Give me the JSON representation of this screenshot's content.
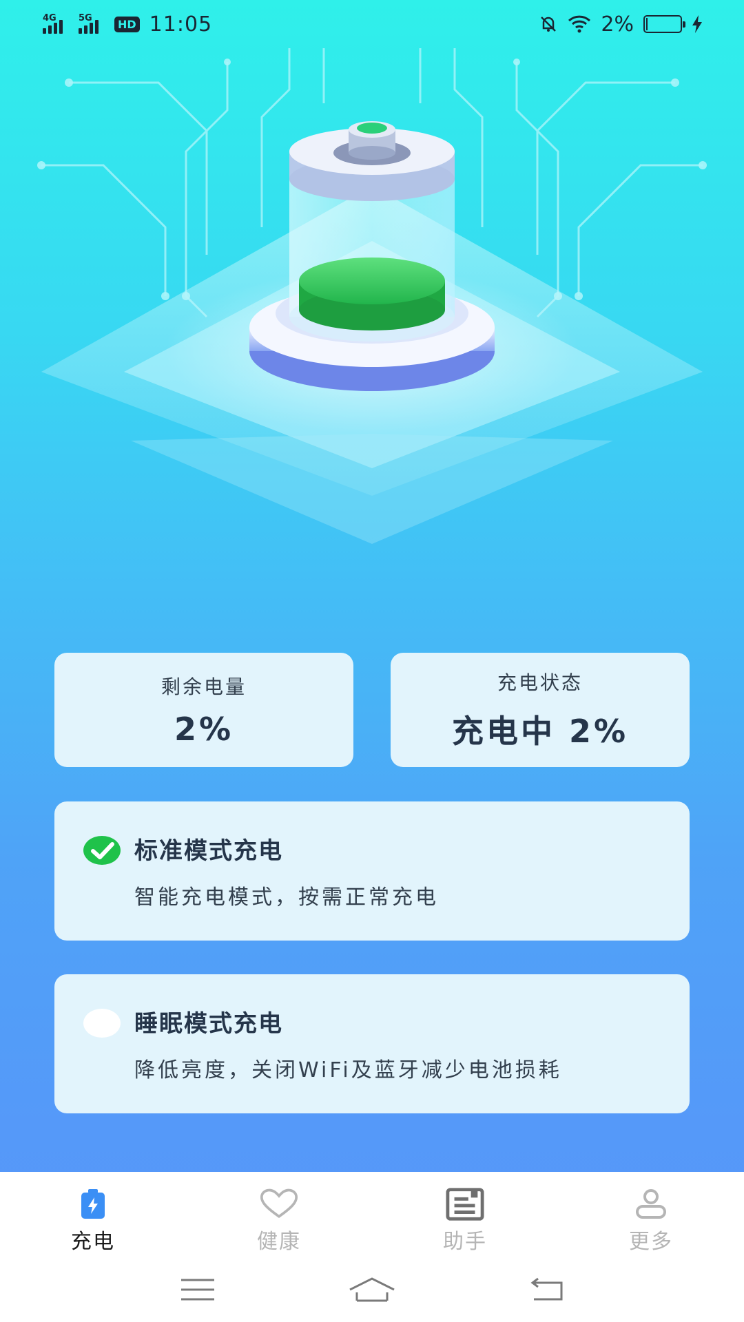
{
  "status_bar": {
    "network_1": "4G",
    "network_2": "5G",
    "hd_badge": "HD",
    "time": "11:05",
    "battery_percent": "2%",
    "battery_level": 0.02,
    "icons": [
      "signal-icon",
      "signal-icon",
      "hd-icon",
      "mute-bell-icon",
      "wifi-icon",
      "battery-icon",
      "charging-bolt-icon"
    ]
  },
  "info": {
    "remaining_label": "剩余电量",
    "remaining_value": "2%",
    "status_label": "充电状态",
    "status_value": "充电中 2%"
  },
  "modes": [
    {
      "title": "标准模式充电",
      "desc": "智能充电模式，按需正常充电",
      "selected": true
    },
    {
      "title": "睡眠模式充电",
      "desc": "降低亮度，关闭WiFi及蓝牙减少电池损耗",
      "selected": false
    }
  ],
  "tabs": [
    {
      "label": "充电",
      "icon": "charge-icon",
      "active": true
    },
    {
      "label": "健康",
      "icon": "heart-icon",
      "active": false
    },
    {
      "label": "助手",
      "icon": "assistant-icon",
      "active": false
    },
    {
      "label": "更多",
      "icon": "user-icon",
      "active": false
    }
  ],
  "nav": {
    "icons": [
      "menu-icon",
      "home-icon",
      "back-icon"
    ]
  },
  "colors": {
    "accent_green": "#1fc24a",
    "active_tab": "#3b8ff5",
    "card_bg": "#e2f4fc"
  }
}
